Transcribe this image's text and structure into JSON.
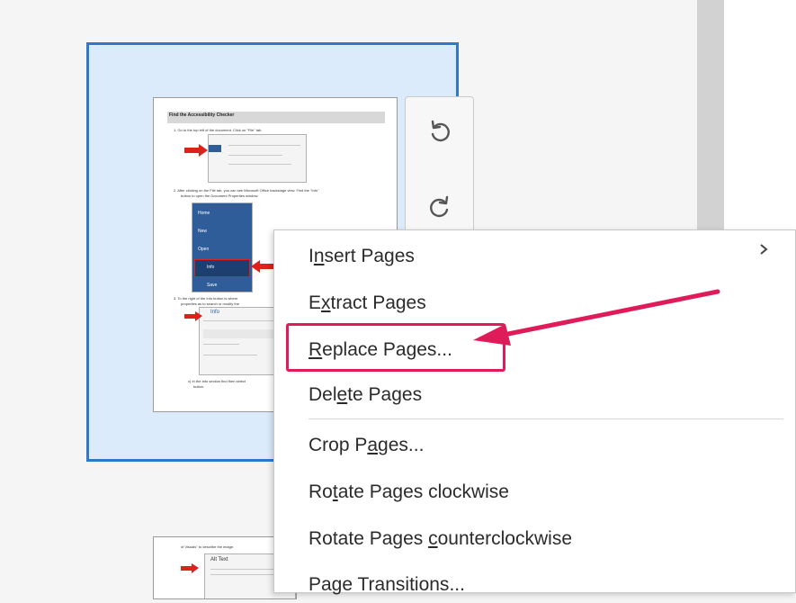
{
  "thumbnail_toolbar": {
    "rotate_ccw_icon": "rotate-counterclockwise-icon",
    "rotate_cw_icon": "rotate-clockwise-icon"
  },
  "doc_preview": {
    "heading": "Find the Accessibility Checker",
    "line1": "1.  Go to the top left of the document. Click on \"File\" tab.",
    "line2": "2.  After clicking on the File tab, you can see Microsoft Office backstage view. Find the \"Info\"",
    "line2b": "button to open the Document Properties window.",
    "menu_home": "Home",
    "menu_new": "New",
    "menu_open": "Open",
    "menu_info": "Info",
    "menu_save": "Save",
    "line3": "3.  To the right of the Info button is where",
    "line3b": "properties as to search or modify the",
    "info_title": "Info",
    "line4": "c) In the Info section find then select",
    "line4b": "button.",
    "page2_line": "of Visuals\" to describe the image.",
    "page2_box_title": "Alt Text"
  },
  "context_menu": {
    "items": [
      {
        "before": "I",
        "u": "n",
        "after": "sert Pages"
      },
      {
        "before": "E",
        "u": "x",
        "after": "tract Pages"
      },
      {
        "before": "",
        "u": "R",
        "after": "eplace Pages..."
      },
      {
        "before": "Del",
        "u": "e",
        "after": "te Pages"
      },
      {
        "before": "Crop P",
        "u": "a",
        "after": "ges..."
      },
      {
        "before": "Ro",
        "u": "t",
        "after": "ate Pages clockwise"
      },
      {
        "before": "Rotate Pages ",
        "u": "c",
        "after": "ounterclockwise"
      },
      {
        "before": "Page Transitions",
        "u": "",
        "after": "..."
      }
    ],
    "submenu_icon": "chevron-right-icon"
  },
  "colors": {
    "selection_border": "#2f79c8",
    "selection_fill": "#dcebfb",
    "highlight": "#e01b5a"
  }
}
